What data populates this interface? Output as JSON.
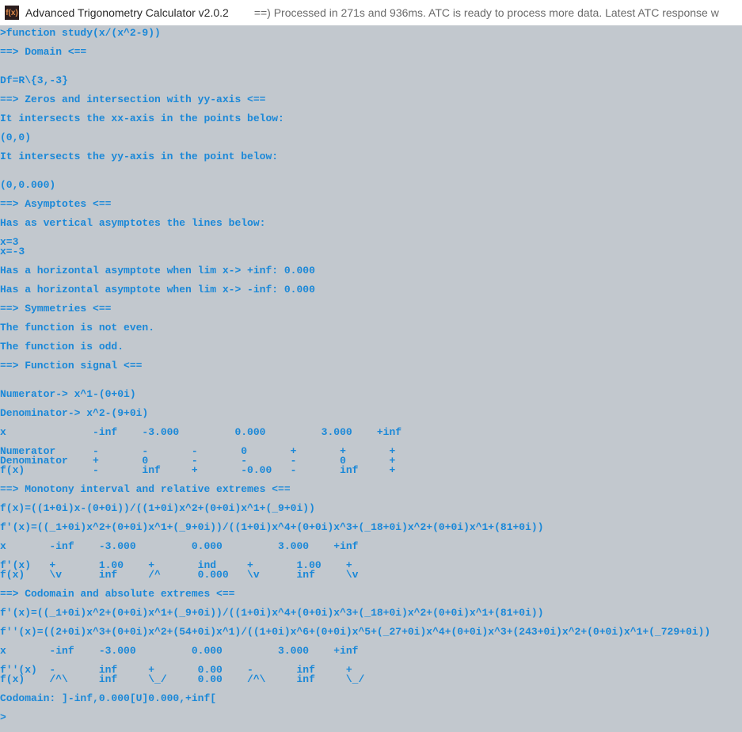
{
  "titlebar": {
    "icon_text": "f(x)",
    "app_title": "Advanced Trigonometry Calculator v2.0.2",
    "status": "==) Processed in 271s and 936ms. ATC is ready to process more data. Latest ATC response w"
  },
  "terminal": {
    "lines": [
      ">function study(x/(x^2-9))",
      "",
      "==> Domain <==",
      "",
      "",
      "Df=R\\{3,-3}",
      "",
      "==> Zeros and intersection with yy-axis <==",
      "",
      "It intersects the xx-axis in the points below:",
      "",
      "(0,0)",
      "",
      "It intersects the yy-axis in the point below:",
      "",
      "",
      "(0,0.000)",
      "",
      "==> Asymptotes <==",
      "",
      "Has as vertical asymptotes the lines below:",
      "",
      "x=3",
      "x=-3",
      "",
      "Has a horizontal asymptote when lim x-> +inf: 0.000",
      "",
      "Has a horizontal asymptote when lim x-> -inf: 0.000",
      "",
      "==> Symmetries <==",
      "",
      "The function is not even.",
      "",
      "The function is odd.",
      "",
      "==> Function signal <==",
      "",
      "",
      "Numerator-> x^1-(0+0i)",
      "",
      "Denominator-> x^2-(9+0i)",
      "",
      "x              -inf    -3.000         0.000         3.000    +inf",
      "",
      "Numerator      -       -       -       0       +       +       +",
      "Denominator    +       0       -       -       -       0       +",
      "f(x)           -       inf     +       -0.00   -       inf     +",
      "",
      "==> Monotony interval and relative extremes <==",
      "",
      "f(x)=((1+0i)x-(0+0i))/((1+0i)x^2+(0+0i)x^1+(_9+0i))",
      "",
      "f'(x)=((_1+0i)x^2+(0+0i)x^1+(_9+0i))/((1+0i)x^4+(0+0i)x^3+(_18+0i)x^2+(0+0i)x^1+(81+0i))",
      "",
      "x       -inf    -3.000         0.000         3.000    +inf",
      "",
      "f'(x)   +       1.00    +       ind     +       1.00    +",
      "f(x)    \\v      inf     /^      0.000   \\v      inf     \\v",
      "",
      "==> Codomain and absolute extremes <==",
      "",
      "f'(x)=((_1+0i)x^2+(0+0i)x^1+(_9+0i))/((1+0i)x^4+(0+0i)x^3+(_18+0i)x^2+(0+0i)x^1+(81+0i))",
      "",
      "f''(x)=((2+0i)x^3+(0+0i)x^2+(54+0i)x^1)/((1+0i)x^6+(0+0i)x^5+(_27+0i)x^4+(0+0i)x^3+(243+0i)x^2+(0+0i)x^1+(_729+0i))",
      "",
      "x       -inf    -3.000         0.000         3.000    +inf",
      "",
      "f''(x)  -       inf     +       0.00    -       inf     +",
      "f(x)    /^\\     inf     \\_/     0.00    /^\\     inf     \\_/",
      "",
      "Codomain: ]-inf,0.000[U]0.000,+inf[",
      "",
      ">"
    ]
  }
}
